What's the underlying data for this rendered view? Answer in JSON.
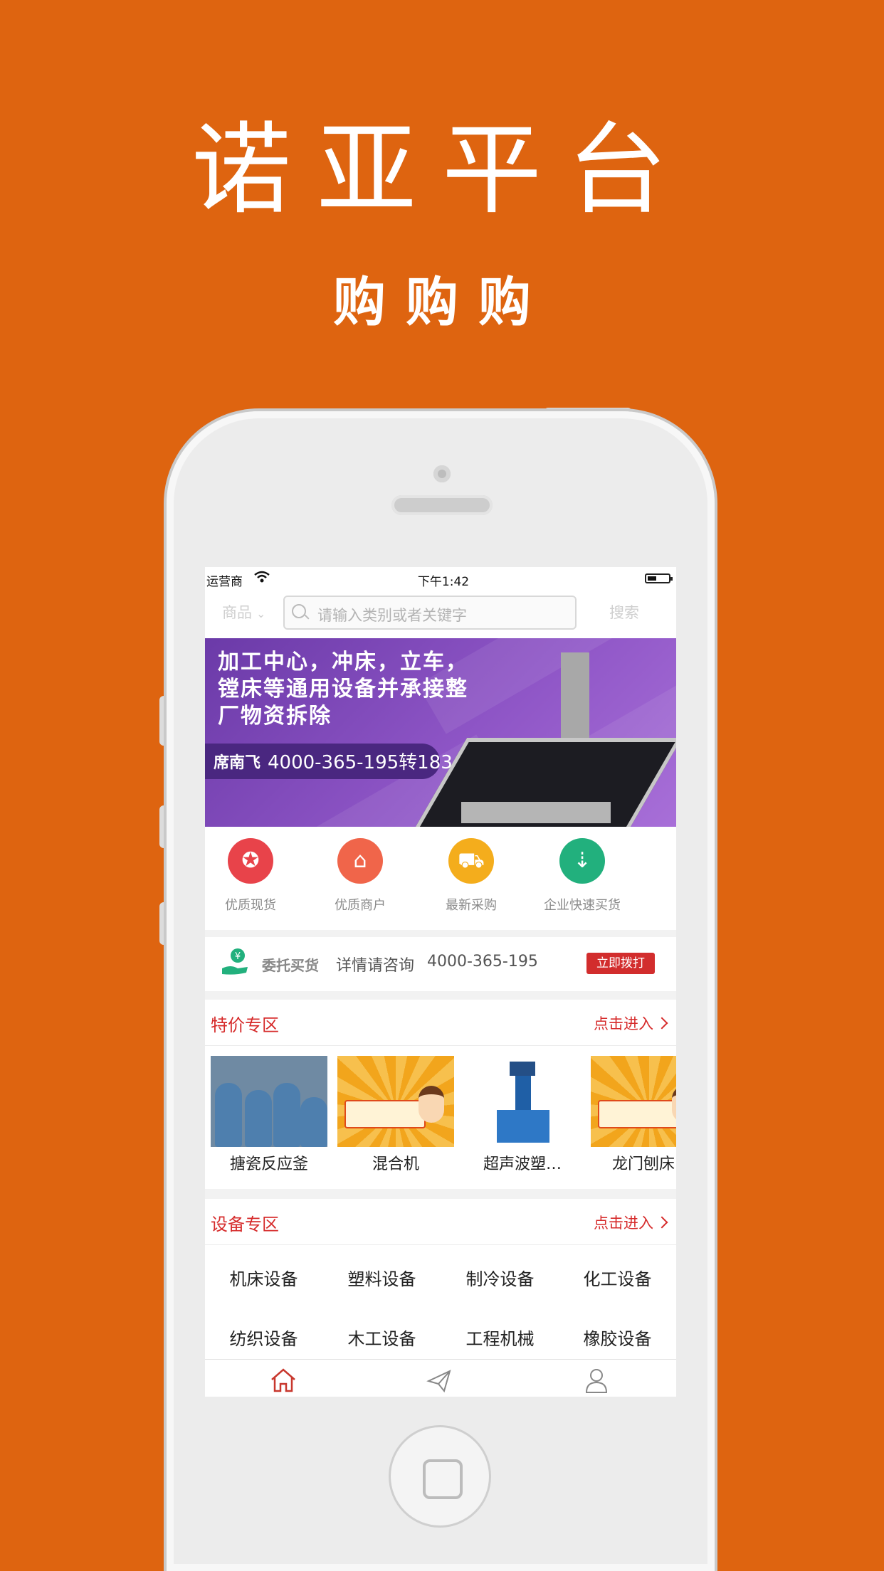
{
  "promo": {
    "title": "诺亚平台",
    "subtitle": "购购购"
  },
  "status_bar": {
    "carrier": "运营商",
    "time": "下午1:42"
  },
  "search": {
    "category": "商品",
    "placeholder": "请输入类别或者关键字",
    "button": "搜索"
  },
  "banner": {
    "lines": [
      "加工中心，冲床，立车，",
      "镗床等通用设备并承接整",
      "厂物资拆除"
    ],
    "contact_label": "席南飞",
    "contact_phone": "4000-365-195转183"
  },
  "quick_icons": [
    {
      "label": "优质现货",
      "icon": "medal-icon",
      "color": "#e8434a"
    },
    {
      "label": "优质商户",
      "icon": "shop-icon",
      "color": "#f0654a"
    },
    {
      "label": "最新采购",
      "icon": "cart-icon",
      "color": "#f4ad1c"
    },
    {
      "label": "企业快速买货",
      "icon": "basket-icon",
      "color": "#22b07d"
    }
  ],
  "consult": {
    "title": "委托买货",
    "text": "详情请咨询",
    "phone": "4000-365-195",
    "call_button": "立即拨打"
  },
  "special_section": {
    "title": "特价专区",
    "more": "点击进入",
    "products": [
      {
        "name": "搪瓷反应釜"
      },
      {
        "name": "混合机"
      },
      {
        "name": "超声波塑…"
      },
      {
        "name": "龙门刨床"
      }
    ]
  },
  "equipment_section": {
    "title": "设备专区",
    "more": "点击进入",
    "categories": [
      "机床设备",
      "塑料设备",
      "制冷设备",
      "化工设备",
      "纺织设备",
      "木工设备",
      "工程机械",
      "橡胶设备"
    ]
  },
  "tabbar": {
    "tabs": [
      {
        "icon": "home-icon",
        "active": true
      },
      {
        "icon": "send-icon",
        "active": false
      },
      {
        "icon": "user-icon",
        "active": false
      }
    ],
    "active_color": "#c8372d"
  }
}
